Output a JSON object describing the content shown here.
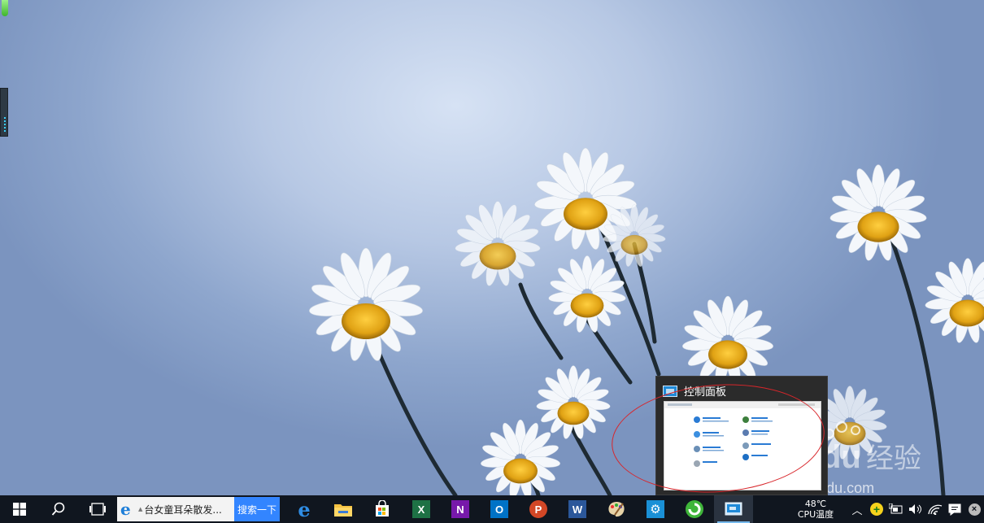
{
  "preview": {
    "title": "控制面板"
  },
  "taskbar": {
    "search_text": "台女童耳朵散发...",
    "search_button": "搜索一下",
    "apps": [
      {
        "name": "edge",
        "label": "e"
      },
      {
        "name": "explorer",
        "label": ""
      },
      {
        "name": "store",
        "label": ""
      },
      {
        "name": "excel",
        "label": "X"
      },
      {
        "name": "onenote",
        "label": "N"
      },
      {
        "name": "outlook",
        "label": "O"
      },
      {
        "name": "powerpoint",
        "label": "P"
      },
      {
        "name": "word",
        "label": "W"
      }
    ],
    "temperature": "48℃",
    "temperature_label": "CPU温度"
  },
  "watermark": {
    "brand": "Bai du 经验",
    "url": "jingyan.baidu.com"
  }
}
